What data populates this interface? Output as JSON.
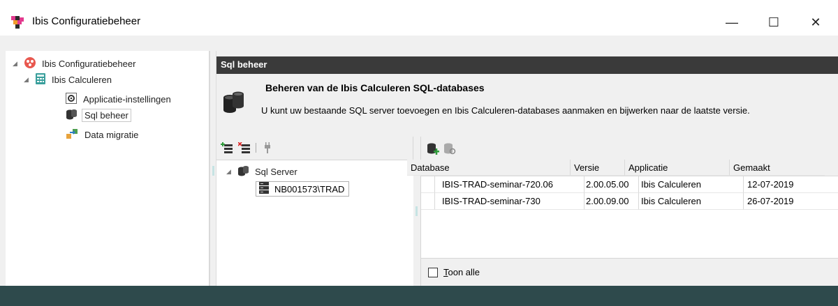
{
  "window": {
    "title": "Ibis Configuratiebeheer",
    "minimize_glyph": "—",
    "maximize_glyph": "☐",
    "close_glyph": "✕"
  },
  "tree": {
    "root": "Ibis Configuratiebeheer",
    "child": "Ibis Calculeren",
    "items": [
      {
        "label": "Applicatie-instellingen",
        "icon": "settings-icon"
      },
      {
        "label": "Sql beheer",
        "icon": "database-icon",
        "selected": true
      },
      {
        "label": "Data migratie",
        "icon": "data-migration-icon"
      }
    ]
  },
  "panel": {
    "header": "Sql beheer",
    "info_title": "Beheren van de Ibis Calculeren SQL-databases",
    "info_desc": "U kunt uw bestaande SQL server toevoegen en Ibis Calculeren-databases aanmaken en bijwerken naar de laatste versie."
  },
  "servers": {
    "root": "Sql Server",
    "node": "NB001573\\TRAD"
  },
  "databases": {
    "columns": [
      "Database",
      "Versie",
      "Applicatie",
      "Gemaakt"
    ],
    "rows": [
      {
        "database": "IBIS-TRAD-seminar-720.06",
        "versie": "2.00.05.00",
        "applicatie": "Ibis Calculeren",
        "gemaakt": "12-07-2019"
      },
      {
        "database": "IBIS-TRAD-seminar-730",
        "versie": "2.00.09.00",
        "applicatie": "Ibis Calculeren",
        "gemaakt": "26-07-2019"
      }
    ],
    "show_all_first": "T",
    "show_all_rest": "oon alle"
  },
  "colors": {
    "header_bg": "#3a3a3a",
    "status_bg": "#2e4a4c",
    "panel_bg": "#f0f0f0"
  }
}
